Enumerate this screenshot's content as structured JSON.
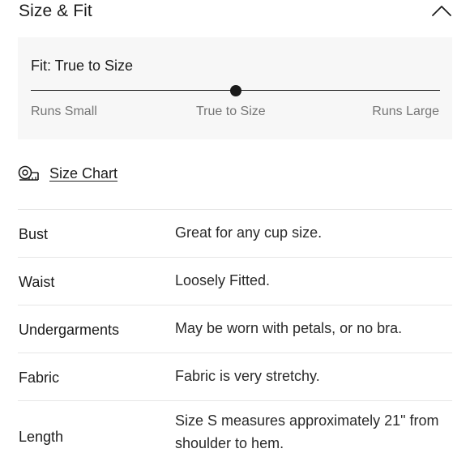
{
  "header": {
    "title": "Size & Fit",
    "collapse_icon": "chevron-up-icon"
  },
  "fit": {
    "label": "Fit: True to Size",
    "level": 0.5,
    "scale": {
      "left": "Runs Small",
      "middle": "True to Size",
      "right": "Runs Large"
    }
  },
  "size_chart": {
    "icon": "measuring-tape-icon",
    "label": "Size Chart"
  },
  "details": [
    {
      "label": "Bust",
      "value": "Great for any cup size."
    },
    {
      "label": "Waist",
      "value": "Loosely Fitted."
    },
    {
      "label": "Undergarments",
      "value": "May be worn with petals, or no bra."
    },
    {
      "label": "Fabric",
      "value": "Fabric is very stretchy."
    },
    {
      "label": "Length",
      "value": "Size S measures approximately 21\" from shoulder to hem."
    }
  ]
}
